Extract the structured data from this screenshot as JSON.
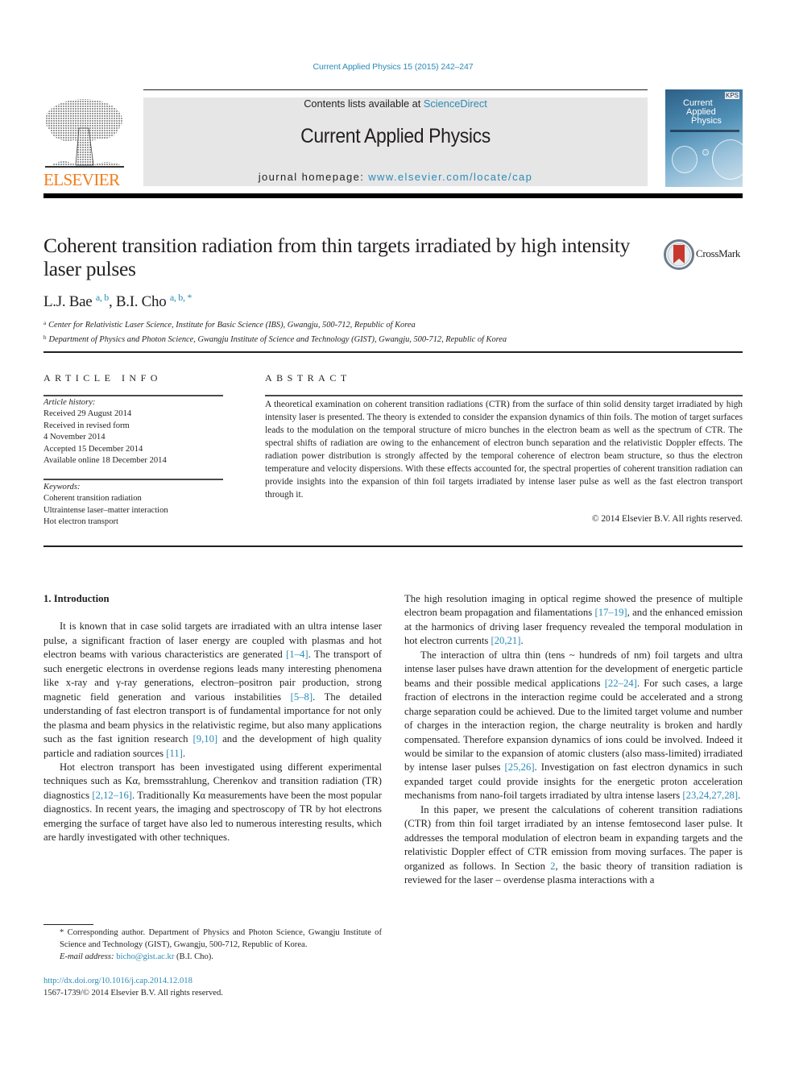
{
  "header": {
    "journal_reference": "Current Applied Physics 15 (2015) 242–247",
    "contents_prefix": "Contents lists available at ",
    "contents_link": "ScienceDirect",
    "journal_title": "Current Applied Physics",
    "homepage_prefix": "journal homepage: ",
    "homepage_link": "www.elsevier.com/locate/cap",
    "publisher_logo_text": "ELSEVIER",
    "cover": {
      "line1": "Current",
      "line2": "Applied",
      "line3": "Physics",
      "badge": "KPS"
    }
  },
  "article": {
    "title": "Coherent transition radiation from thin targets irradiated by high intensity laser pulses",
    "crossmark_label": "CrossMark",
    "authors": [
      {
        "name": "L.J. Bae",
        "sup": "a, b"
      },
      {
        "name": "B.I. Cho",
        "sup": "a, b, *"
      }
    ],
    "affiliations": [
      {
        "mark": "a",
        "text": "Center for Relativistic Laser Science, Institute for Basic Science (IBS), Gwangju, 500-712, Republic of Korea"
      },
      {
        "mark": "b",
        "text": "Department of Physics and Photon Science, Gwangju Institute of Science and Technology (GIST), Gwangju, 500-712, Republic of Korea"
      }
    ]
  },
  "article_info": {
    "heading": "ARTICLE INFO",
    "history_label": "Article history:",
    "history": [
      "Received 29 August 2014",
      "Received in revised form",
      "4 November 2014",
      "Accepted 15 December 2014",
      "Available online 18 December 2014"
    ],
    "keywords_label": "Keywords:",
    "keywords": [
      "Coherent transition radiation",
      "Ultraintense laser–matter interaction",
      "Hot electron transport"
    ]
  },
  "abstract": {
    "heading": "ABSTRACT",
    "body": "A theoretical examination on coherent transition radiations (CTR) from the surface of thin solid density target irradiated by high intensity laser is presented. The theory is extended to consider the expansion dynamics of thin foils. The motion of target surfaces leads to the modulation on the temporal structure of micro bunches in the electron beam as well as the spectrum of CTR. The spectral shifts of radiation are owing to the enhancement of electron bunch separation and the relativistic Doppler effects. The radiation power distribution is strongly affected by the temporal coherence of electron beam structure, so thus the electron temperature and velocity dispersions. With these effects accounted for, the spectral properties of coherent transition radiation can provide insights into the expansion of thin foil targets irradiated by intense laser pulse as well as the fast electron transport through it.",
    "copyright": "© 2014 Elsevier B.V. All rights reserved."
  },
  "body": {
    "section_heading": "1.  Introduction",
    "left_paragraphs": [
      {
        "segments": [
          {
            "t": "It is known that in case solid targets are irradiated with an ultra intense laser pulse, a significant fraction of laser energy are coupled with plasmas and hot electron beams with various characteristics are generated "
          },
          {
            "c": "[1–4]"
          },
          {
            "t": ". The transport of such energetic electrons in overdense regions leads many interesting phenomena like x-ray and γ-ray generations, electron–positron pair production, strong magnetic field generation and various instabilities "
          },
          {
            "c": "[5–8]"
          },
          {
            "t": ". The detailed understanding of fast electron transport is of fundamental importance for not only the plasma and beam physics in the relativistic regime, but also many applications such as the fast ignition research "
          },
          {
            "c": "[9,10]"
          },
          {
            "t": " and the development of high quality particle and radiation sources "
          },
          {
            "c": "[11]"
          },
          {
            "t": "."
          }
        ]
      },
      {
        "segments": [
          {
            "t": "Hot electron transport has been investigated using different experimental techniques such as Kα, bremsstrahlung, Cherenkov and transition radiation (TR) diagnostics "
          },
          {
            "c": "[2,12–16]"
          },
          {
            "t": ". Traditionally Kα measurements have been the most popular diagnostics. In recent years, the imaging and spectroscopy of TR by hot electrons emerging the surface of target have also led to numerous interesting results, which are hardly investigated with other techniques."
          }
        ]
      }
    ],
    "right_paragraphs": [
      {
        "segments": [
          {
            "t": "The high resolution imaging in optical regime showed the presence of multiple electron beam propagation and filamentations "
          },
          {
            "c": "[17–19]"
          },
          {
            "t": ", and the enhanced emission at the harmonics of driving laser frequency revealed the temporal modulation in hot electron currents "
          },
          {
            "c": "[20,21]"
          },
          {
            "t": "."
          }
        ]
      },
      {
        "segments": [
          {
            "t": "The interaction of ultra thin (tens ~ hundreds of nm) foil targets and ultra intense laser pulses have drawn attention for the development of energetic particle beams and their possible medical applications "
          },
          {
            "c": "[22–24]"
          },
          {
            "t": ". For such cases, a large fraction of electrons in the interaction regime could be accelerated and a strong charge separation could be achieved. Due to the limited target volume and number of charges in the interaction region, the charge neutrality is broken and hardly compensated. Therefore expansion dynamics of ions could be involved. Indeed it would be similar to the expansion of atomic clusters (also mass-limited) irradiated by intense laser pulses "
          },
          {
            "c": "[25,26]"
          },
          {
            "t": ". Investigation on fast electron dynamics in such expanded target could provide insights for the energetic proton acceleration mechanisms from nano-foil targets irradiated by ultra intense lasers "
          },
          {
            "c": "[23,24,27,28]"
          },
          {
            "t": "."
          }
        ]
      },
      {
        "segments": [
          {
            "t": "In this paper, we present the calculations of coherent transition radiations (CTR) from thin foil target irradiated by an intense femtosecond laser pulse. It addresses the temporal modulation of electron beam in expanding targets and the relativistic Doppler effect of CTR emission from moving surfaces. The paper is organized as follows. In Section "
          },
          {
            "c": "2"
          },
          {
            "t": ", the basic theory of transition radiation is reviewed for the laser – overdense plasma interactions with a"
          }
        ]
      }
    ]
  },
  "footnote": {
    "corresponding": "* Corresponding author. Department of Physics and Photon Science, Gwangju Institute of Science and Technology (GIST), Gwangju, 500-712, Republic of Korea.",
    "email_label": "E-mail address: ",
    "email": "bicho@gist.ac.kr",
    "email_suffix": " (B.I. Cho).",
    "doi": "http://dx.doi.org/10.1016/j.cap.2014.12.018",
    "issn_copyright": "1567-1739/© 2014 Elsevier B.V. All rights reserved."
  },
  "colors": {
    "link": "#2a8bb8",
    "elsevier_orange": "#f07c1a",
    "masthead_bg": "#e6e6e6",
    "text": "#231f20"
  }
}
